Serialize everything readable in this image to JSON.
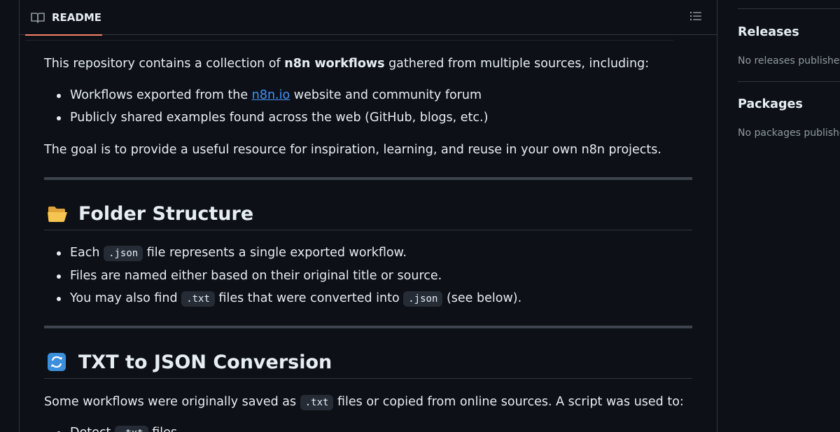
{
  "readme": {
    "tab_label": "README",
    "intro": {
      "before": "This repository contains a collection of ",
      "bold": "n8n workflows",
      "after": " gathered from multiple sources, including:"
    },
    "sources": [
      {
        "before": "Workflows exported from the ",
        "link": "n8n.io",
        "after": " website and community forum"
      },
      {
        "text": "Publicly shared examples found across the web (GitHub, blogs, etc.)"
      }
    ],
    "goal": "The goal is to provide a useful resource for inspiration, learning, and reuse in your own n8n projects.",
    "folder_section": {
      "emoji": "📂",
      "title": "Folder Structure",
      "items": [
        {
          "before": "Each ",
          "code": ".json",
          "after": " file represents a single exported workflow."
        },
        {
          "text": "Files are named either based on their original title or source."
        },
        {
          "before": "You may also find ",
          "code": ".txt",
          "middle": " files that were converted into ",
          "code2": ".json",
          "after": " (see below)."
        }
      ]
    },
    "conversion_section": {
      "emoji": "🔄",
      "title": "TXT to JSON Conversion",
      "intro_before": "Some workflows were originally saved as ",
      "intro_code": ".txt",
      "intro_after": " files or copied from online sources. A script was used to:",
      "first_item_partial": "Detect",
      "first_item_code": ".txt",
      "first_item_after": " files"
    }
  },
  "sidebar": {
    "releases": {
      "title": "Releases",
      "empty": "No releases published"
    },
    "packages": {
      "title": "Packages",
      "empty": "No packages published"
    }
  },
  "colors": {
    "background": "#0d1117",
    "text": "#e6edf3",
    "muted": "#9198a1",
    "link": "#4493f8",
    "tab_accent": "#f78166",
    "border": "#30363d"
  },
  "icons": {
    "tab": "book-icon",
    "toc": "list-unordered-icon",
    "folder": "open-folder-emoji",
    "conversion": "arrows-cycle-emoji"
  }
}
